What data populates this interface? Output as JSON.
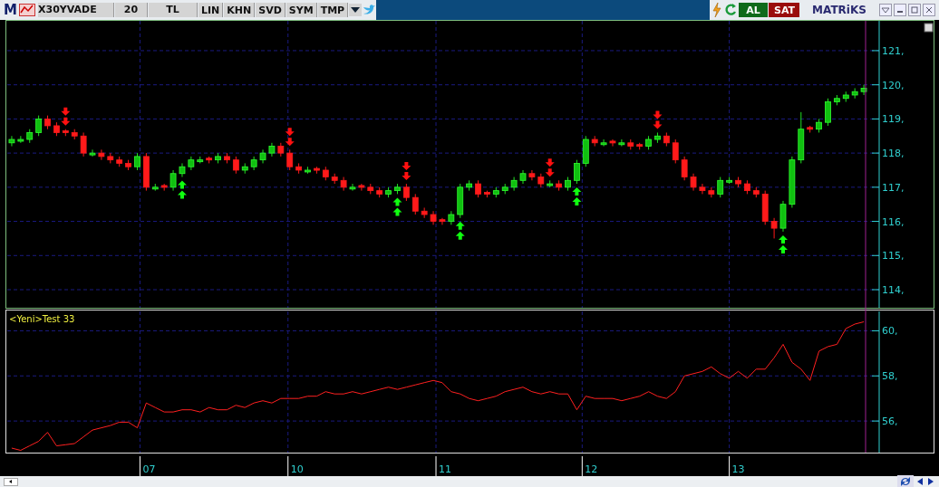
{
  "toolbar": {
    "logo": "M",
    "symbol": "X30YVADE",
    "period": "20",
    "currency": "TL",
    "buttons": [
      "LIN",
      "KHN",
      "SVD",
      "SYM",
      "TMP"
    ],
    "buy_button": "AL",
    "sell_button": "SAT",
    "brand": "MATRiKS"
  },
  "price_panel": {
    "chart_data": {
      "type": "candlestick",
      "grid": true,
      "ylim": [
        113.47,
        121.9
      ],
      "yticks": [
        {
          "value": 114,
          "label": "114,"
        },
        {
          "value": 115,
          "label": "115,"
        },
        {
          "value": 116,
          "label": "116,"
        },
        {
          "value": 117,
          "label": "117,"
        },
        {
          "value": 118,
          "label": "118,"
        },
        {
          "value": 119,
          "label": "119,"
        },
        {
          "value": 120,
          "label": "120,"
        },
        {
          "value": 121,
          "label": "121,"
        }
      ],
      "ohlc": [
        [
          118.3,
          118.5,
          118.2,
          118.4
        ],
        [
          118.35,
          118.5,
          118.3,
          118.4
        ],
        [
          118.4,
          118.7,
          118.3,
          118.6
        ],
        [
          118.6,
          119.1,
          118.5,
          119.0
        ],
        [
          119.0,
          119.1,
          118.7,
          118.8
        ],
        [
          118.8,
          118.9,
          118.5,
          118.6
        ],
        [
          118.65,
          118.7,
          118.5,
          118.6
        ],
        [
          118.6,
          118.7,
          118.4,
          118.5
        ],
        [
          118.5,
          118.6,
          117.9,
          118.0
        ],
        [
          117.95,
          118.1,
          117.9,
          118.0
        ],
        [
          118.0,
          118.1,
          117.8,
          117.9
        ],
        [
          117.9,
          118.0,
          117.7,
          117.8
        ],
        [
          117.8,
          117.9,
          117.6,
          117.7
        ],
        [
          117.7,
          117.8,
          117.5,
          117.6
        ],
        [
          117.6,
          118.0,
          117.5,
          117.9
        ],
        [
          117.9,
          118.0,
          116.9,
          117.0
        ],
        [
          116.95,
          117.1,
          116.9,
          117.0
        ],
        [
          117.05,
          117.1,
          116.9,
          117.0
        ],
        [
          117.0,
          117.5,
          116.9,
          117.4
        ],
        [
          117.4,
          117.7,
          117.3,
          117.6
        ],
        [
          117.6,
          117.9,
          117.5,
          117.8
        ],
        [
          117.75,
          117.9,
          117.7,
          117.8
        ],
        [
          117.85,
          117.9,
          117.7,
          117.8
        ],
        [
          117.8,
          118.0,
          117.7,
          117.9
        ],
        [
          117.9,
          118.0,
          117.7,
          117.8
        ],
        [
          117.8,
          117.9,
          117.4,
          117.5
        ],
        [
          117.5,
          117.7,
          117.4,
          117.6
        ],
        [
          117.6,
          117.9,
          117.5,
          117.8
        ],
        [
          117.8,
          118.1,
          117.7,
          118.0
        ],
        [
          118.0,
          118.3,
          117.9,
          118.2
        ],
        [
          118.2,
          118.3,
          117.9,
          118.0
        ],
        [
          118.0,
          118.1,
          117.5,
          117.6
        ],
        [
          117.6,
          117.7,
          117.4,
          117.5
        ],
        [
          117.45,
          117.6,
          117.4,
          117.5
        ],
        [
          117.55,
          117.6,
          117.4,
          117.5
        ],
        [
          117.5,
          117.6,
          117.2,
          117.3
        ],
        [
          117.3,
          117.4,
          117.1,
          117.2
        ],
        [
          117.2,
          117.3,
          116.9,
          117.0
        ],
        [
          116.95,
          117.1,
          116.9,
          117.0
        ],
        [
          117.05,
          117.1,
          116.9,
          117.0
        ],
        [
          117.0,
          117.1,
          116.8,
          116.9
        ],
        [
          116.9,
          117.0,
          116.7,
          116.8
        ],
        [
          116.8,
          117.0,
          116.7,
          116.9
        ],
        [
          116.9,
          117.1,
          116.8,
          117.0
        ],
        [
          117.0,
          117.1,
          116.6,
          116.7
        ],
        [
          116.7,
          116.8,
          116.2,
          116.3
        ],
        [
          116.3,
          116.4,
          116.1,
          116.2
        ],
        [
          116.2,
          116.3,
          115.9,
          116.0
        ],
        [
          116.05,
          116.1,
          115.9,
          116.0
        ],
        [
          116.0,
          116.3,
          115.9,
          116.2
        ],
        [
          116.2,
          117.1,
          116.1,
          117.0
        ],
        [
          117.0,
          117.2,
          116.9,
          117.1
        ],
        [
          117.1,
          117.2,
          116.7,
          116.8
        ],
        [
          116.85,
          116.9,
          116.7,
          116.8
        ],
        [
          116.8,
          117.0,
          116.7,
          116.9
        ],
        [
          116.9,
          117.1,
          116.8,
          117.0
        ],
        [
          117.0,
          117.3,
          116.9,
          117.2
        ],
        [
          117.2,
          117.5,
          117.1,
          117.4
        ],
        [
          117.4,
          117.5,
          117.2,
          117.3
        ],
        [
          117.3,
          117.4,
          117.0,
          117.1
        ],
        [
          117.05,
          117.2,
          117.0,
          117.1
        ],
        [
          117.1,
          117.2,
          116.9,
          117.0
        ],
        [
          117.0,
          117.3,
          116.9,
          117.2
        ],
        [
          117.2,
          117.8,
          117.1,
          117.7
        ],
        [
          117.7,
          118.5,
          117.6,
          118.4
        ],
        [
          118.4,
          118.5,
          118.2,
          118.3
        ],
        [
          118.25,
          118.4,
          118.2,
          118.3
        ],
        [
          118.35,
          118.4,
          118.2,
          118.3
        ],
        [
          118.25,
          118.4,
          118.2,
          118.3
        ],
        [
          118.3,
          118.4,
          118.1,
          118.2
        ],
        [
          118.25,
          118.3,
          118.1,
          118.2
        ],
        [
          118.2,
          118.5,
          118.1,
          118.4
        ],
        [
          118.4,
          118.6,
          118.3,
          118.5
        ],
        [
          118.5,
          118.6,
          118.2,
          118.3
        ],
        [
          118.3,
          118.4,
          117.7,
          117.8
        ],
        [
          117.8,
          117.9,
          117.2,
          117.3
        ],
        [
          117.3,
          117.4,
          116.9,
          117.0
        ],
        [
          117.0,
          117.1,
          116.8,
          116.9
        ],
        [
          116.9,
          117.0,
          116.7,
          116.8
        ],
        [
          116.8,
          117.3,
          116.7,
          117.2
        ],
        [
          117.15,
          117.3,
          117.1,
          117.2
        ],
        [
          117.2,
          117.3,
          117.0,
          117.1
        ],
        [
          117.1,
          117.2,
          116.8,
          116.9
        ],
        [
          116.9,
          117.0,
          116.7,
          116.8
        ],
        [
          116.8,
          116.9,
          115.9,
          116.0
        ],
        [
          116.0,
          116.1,
          115.5,
          115.8
        ],
        [
          115.8,
          116.6,
          115.7,
          116.5
        ],
        [
          116.5,
          117.9,
          116.4,
          117.8
        ],
        [
          117.8,
          119.2,
          117.7,
          118.7
        ],
        [
          118.75,
          118.8,
          118.6,
          118.7
        ],
        [
          118.7,
          119.0,
          118.6,
          118.9
        ],
        [
          118.9,
          119.6,
          118.8,
          119.5
        ],
        [
          119.5,
          119.7,
          119.4,
          119.6
        ],
        [
          119.6,
          119.8,
          119.5,
          119.7
        ],
        [
          119.7,
          119.9,
          119.6,
          119.8
        ],
        [
          119.8,
          120.0,
          119.7,
          119.9
        ]
      ]
    },
    "sell_signals": [
      false,
      false,
      false,
      false,
      false,
      false,
      true,
      false,
      false,
      false,
      false,
      false,
      false,
      false,
      false,
      false,
      false,
      false,
      false,
      false,
      false,
      false,
      false,
      false,
      false,
      false,
      false,
      false,
      false,
      false,
      false,
      true,
      false,
      false,
      false,
      false,
      false,
      false,
      false,
      false,
      false,
      false,
      false,
      false,
      true,
      false,
      false,
      false,
      false,
      false,
      false,
      false,
      false,
      false,
      false,
      false,
      false,
      false,
      false,
      false,
      true,
      false,
      false,
      false,
      false,
      false,
      false,
      false,
      false,
      false,
      false,
      false,
      true,
      false,
      false,
      false,
      false,
      false,
      false,
      false,
      false,
      false,
      false,
      false,
      false,
      false,
      false,
      false,
      false,
      false,
      false,
      false,
      false,
      false,
      false,
      false
    ],
    "buy_signals": [
      false,
      false,
      false,
      false,
      false,
      false,
      false,
      false,
      false,
      false,
      false,
      false,
      false,
      false,
      false,
      false,
      false,
      false,
      false,
      true,
      false,
      false,
      false,
      false,
      false,
      false,
      false,
      false,
      false,
      false,
      false,
      false,
      false,
      false,
      false,
      false,
      false,
      false,
      false,
      false,
      false,
      false,
      false,
      true,
      false,
      false,
      false,
      false,
      false,
      false,
      true,
      false,
      false,
      false,
      false,
      false,
      false,
      false,
      false,
      false,
      false,
      false,
      false,
      true,
      false,
      false,
      false,
      false,
      false,
      false,
      false,
      false,
      false,
      false,
      false,
      false,
      false,
      false,
      false,
      false,
      false,
      false,
      false,
      false,
      false,
      false,
      true,
      false,
      false,
      false,
      false,
      false,
      false,
      false,
      false,
      false
    ]
  },
  "indicator_panel": {
    "chart_data": {
      "type": "line",
      "grid": true,
      "ylim": [
        54.6,
        60.9
      ],
      "yticks": [
        {
          "value": 56,
          "label": "56,"
        },
        {
          "value": 58,
          "label": "58,"
        },
        {
          "value": 60,
          "label": "60,"
        }
      ],
      "series": [
        {
          "name": "<Yeni>Test 33",
          "color": "#ff2020",
          "values": [
            54.8,
            54.7,
            54.9,
            55.1,
            55.5,
            54.9,
            54.95,
            55.0,
            55.3,
            55.6,
            55.7,
            55.8,
            55.95,
            55.95,
            55.7,
            56.8,
            56.6,
            56.4,
            56.4,
            56.5,
            56.5,
            56.4,
            56.6,
            56.5,
            56.5,
            56.7,
            56.6,
            56.8,
            56.9,
            56.8,
            57.0,
            57.0,
            57.0,
            57.1,
            57.1,
            57.3,
            57.2,
            57.2,
            57.3,
            57.2,
            57.3,
            57.4,
            57.5,
            57.4,
            57.5,
            57.6,
            57.7,
            57.8,
            57.7,
            57.3,
            57.2,
            57.0,
            56.9,
            57.0,
            57.1,
            57.3,
            57.4,
            57.5,
            57.3,
            57.2,
            57.3,
            57.2,
            57.2,
            56.5,
            57.1,
            57.0,
            57.0,
            57.0,
            56.9,
            57.0,
            57.1,
            57.3,
            57.1,
            57.0,
            57.3,
            58.0,
            58.1,
            58.2,
            58.4,
            58.1,
            57.9,
            58.2,
            57.9,
            58.3,
            58.3,
            58.8,
            59.4,
            58.6,
            58.3,
            57.8,
            59.1,
            59.3,
            59.4,
            60.1,
            60.3,
            60.4
          ]
        }
      ]
    }
  },
  "time_axis": {
    "labels": [
      "07",
      "10",
      "11",
      "12",
      "13"
    ]
  }
}
